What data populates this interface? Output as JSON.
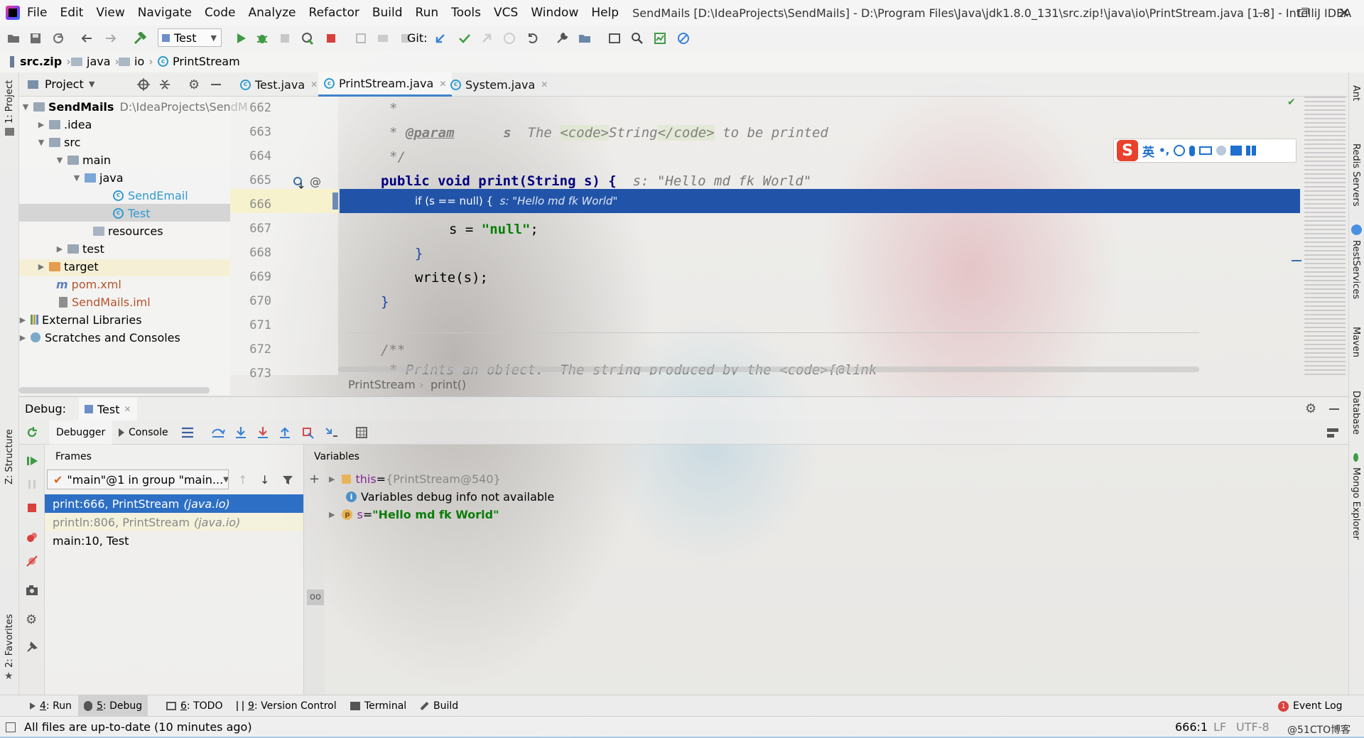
{
  "app": {
    "menu": [
      "File",
      "Edit",
      "View",
      "Navigate",
      "Code",
      "Analyze",
      "Refactor",
      "Build",
      "Run",
      "Tools",
      "VCS",
      "Window",
      "Help"
    ],
    "title": "SendMails [D:\\IdeaProjects\\SendMails] - D:\\Program Files\\Java\\jdk1.8.0_131\\src.zip!\\java\\io\\PrintStream.java [1.8] - IntelliJ IDEA"
  },
  "toolbar": {
    "run_config": "Test",
    "git_label": "Git:"
  },
  "breadcrumb": [
    "src.zip",
    "java",
    "io",
    "PrintStream"
  ],
  "project": {
    "header": "Project",
    "root_name": "SendMails",
    "root_path": "D:\\IdeaProjects\\SendM",
    "nodes": [
      ".idea",
      "src",
      "main",
      "java",
      "SendEmail",
      "Test",
      "resources",
      "test",
      "target",
      "pom.xml",
      "SendMails.iml",
      "External Libraries",
      "Scratches and Consoles"
    ]
  },
  "left_stripe": {
    "project": "1: Project",
    "structure": "Z: Structure",
    "favorites": "2: Favorites"
  },
  "right_stripe": [
    "Ant",
    "Redis Servers",
    "RestServices",
    "Maven",
    "Database",
    "Mongo Explorer"
  ],
  "editor": {
    "tabs": [
      "Test.java",
      "PrintStream.java",
      "System.java"
    ],
    "active_tab": "PrintStream.java",
    "line_numbers": [
      "662",
      "663",
      "664",
      "665",
      "666",
      "667",
      "668",
      "669",
      "670",
      "671",
      "672",
      "673"
    ],
    "lines": {
      "l662": "*",
      "l663_star": "*",
      "l663_tag": "@param",
      "l663_name": "s",
      "l663_text1": "The",
      "l663_code_open": "<code>",
      "l663_type": "String",
      "l663_code_close": "</code>",
      "l663_text2": "to be printed",
      "l664": "*/",
      "l665_code": "public void print(String s) {",
      "l665_hint": "s: \"Hello md fk World\"",
      "l666_code": "if (s == null) {",
      "l666_hint": "s: \"Hello md fk World\"",
      "l667_var": "s = ",
      "l667_str": "\"null\"",
      "l667_end": ";",
      "l668": "}",
      "l669": "write(s);",
      "l670": "}",
      "l672": "/**",
      "l673": "* Prints an object.  The string produced by the <code>{@link"
    },
    "crumb": [
      "PrintStream",
      "print()"
    ],
    "ime_label": "英"
  },
  "debug": {
    "label": "Debug:",
    "session_tab": "Test",
    "tabs": {
      "debugger": "Debugger",
      "console": "Console"
    },
    "frames_header": "Frames",
    "variables_header": "Variables",
    "thread": "\"main\"@1 in group \"main...",
    "frames": [
      {
        "text": "print:666, PrintStream",
        "pkg": "(java.io)"
      },
      {
        "text": "println:806, PrintStream",
        "pkg": "(java.io)"
      },
      {
        "text": "main:10, Test",
        "pkg": ""
      }
    ],
    "variables": [
      {
        "name": "this",
        "eq": " = ",
        "value": "{PrintStream@540}"
      },
      {
        "info": "Variables debug info not available"
      },
      {
        "name": "s",
        "eq": " = ",
        "value": "\"Hello md fk World\""
      }
    ]
  },
  "bottom_tabs": [
    {
      "num": "4",
      "label": ": Run"
    },
    {
      "num": "5",
      "label": ": Debug"
    },
    {
      "num": "6",
      "label": ": TODO"
    },
    {
      "num": "9",
      "label": ": Version Control"
    },
    {
      "num": "",
      "label": "Terminal"
    },
    {
      "num": "",
      "label": "Build"
    }
  ],
  "event_log": {
    "count": "1",
    "label": "Event Log"
  },
  "status": {
    "message": "All files are up-to-date (10 minutes ago)",
    "position": "666:1",
    "line_sep": "LF",
    "encoding": "UTF-8",
    "watermark": "@51CTO博客"
  },
  "colors": {
    "exec_line": "#2154a8",
    "accent": "#4083c9",
    "keyword": "#000080",
    "string": "#008000"
  }
}
